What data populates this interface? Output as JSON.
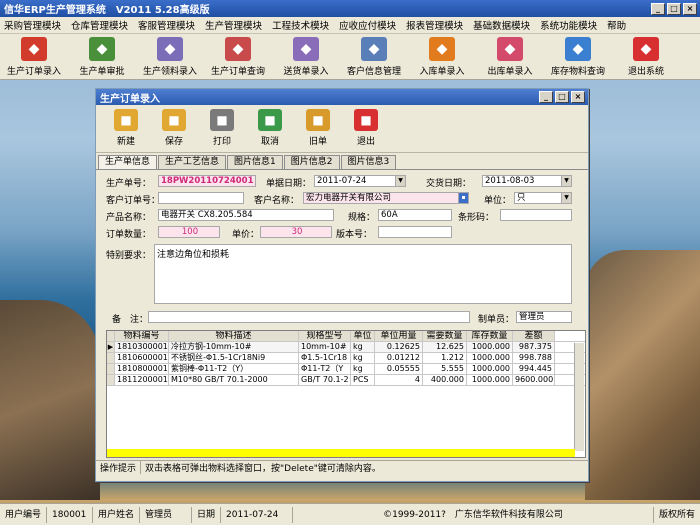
{
  "app": {
    "title": "信华ERP生产管理系统　V2011 5.28高级版"
  },
  "menu": [
    "采购管理模块",
    "仓库管理模块",
    "客服管理模块",
    "生产管理模块",
    "工程技术模块",
    "应收应付模块",
    "报表管理模块",
    "基础数据模块",
    "系统功能模块",
    "帮助"
  ],
  "toolbar": [
    {
      "label": "生产订单录入",
      "icon": "pdf-icon",
      "color": "#d23b2b"
    },
    {
      "label": "生产单审批",
      "icon": "plant-icon",
      "color": "#4a8f3a"
    },
    {
      "label": "生产领料录入",
      "icon": "document-icon",
      "color": "#7b6db8"
    },
    {
      "label": "生产订单查询",
      "icon": "arrow-doc-icon",
      "color": "#c84a4a"
    },
    {
      "label": "送货单录入",
      "icon": "paper-icon",
      "color": "#8a6db8"
    },
    {
      "label": "客户信息管理",
      "icon": "graph-icon",
      "color": "#5a7fb8"
    },
    {
      "label": "入库单录入",
      "icon": "flower-icon",
      "color": "#e27a1e"
    },
    {
      "label": "出库单录入",
      "icon": "flask-icon",
      "color": "#d34a6a"
    },
    {
      "label": "库存物料查询",
      "icon": "feather-icon",
      "color": "#3a7fd0"
    },
    {
      "label": "退出系统",
      "icon": "exit-icon",
      "color": "#d83030"
    }
  ],
  "child": {
    "title": "生产订单录入",
    "toolbar": [
      {
        "label": "新建",
        "icon": "new-icon",
        "color": "#e0a830"
      },
      {
        "label": "保存",
        "icon": "save-icon",
        "color": "#e0a830"
      },
      {
        "label": "打印",
        "icon": "print-icon",
        "color": "#7a7a7a"
      },
      {
        "label": "取消",
        "icon": "cancel-icon",
        "color": "#3a9a4a"
      },
      {
        "label": "旧单",
        "icon": "old-icon",
        "color": "#d89a2a"
      },
      {
        "label": "退出",
        "icon": "exit-icon",
        "color": "#d83030"
      }
    ],
    "tabs": [
      "生产单信息",
      "生产工艺信息",
      "图片信息1",
      "图片信息2",
      "图片信息3"
    ],
    "form": {
      "order_no_label": "生产单号：",
      "order_no": "18PW20110724001",
      "biz_date_label": "单据日期：",
      "biz_date": "2011-07-24",
      "delivery_label": "交货日期：",
      "delivery_date": "2011-08-03",
      "cust_order_label": "客户订单号：",
      "cust_order": "",
      "customer_label": "客户名称：",
      "customer": "宏力电器开关有限公司",
      "unit_label": "单位：",
      "unit": "只",
      "product_label": "产品名称：",
      "product": "电器开关 CX8.205.584",
      "spec_label": "规格：",
      "spec": "60A",
      "barcode_label": "条形码：",
      "barcode": "",
      "qty_label": "订单数量：",
      "qty": "100",
      "price_label": "单价：",
      "price": "30",
      "version_label": "版本号：",
      "version": "",
      "special_label": "特别要求：",
      "special": "注意边角位和损耗",
      "remark_label": "备　注：",
      "remark": "",
      "maker_label": "制单员：",
      "maker": "管理员"
    },
    "grid": {
      "headers": [
        "物料编号",
        "物料描述",
        "规格型号",
        "单位",
        "单位用量",
        "需要数量",
        "库存数量",
        "差额"
      ],
      "rows": [
        [
          "1810300001",
          "冷拉方钢-10mm-10#",
          "10mm-10#",
          "kg",
          "0.12625",
          "12.625",
          "1000.000",
          "987.375"
        ],
        [
          "1810600001",
          "不锈钢丝-Φ1.5-1Cr18Ni9",
          "Φ1.5-1Cr18",
          "kg",
          "0.01212",
          "1.212",
          "1000.000",
          "998.788"
        ],
        [
          "1810800001",
          "紫铜棒-Φ11-T2（Y）",
          "Φ11-T2（Y",
          "kg",
          "0.05555",
          "5.555",
          "1000.000",
          "994.445"
        ],
        [
          "1811200001",
          "M10*80 GB/T 70.1-2000",
          "GB/T 70.1-2",
          "PCS",
          "4",
          "400.000",
          "1000.000",
          "9600.000"
        ]
      ]
    },
    "hint": {
      "key": "操作提示",
      "text": "双击表格可弹出物料选择窗口，按\"Delete\"键可清除内容。"
    }
  },
  "status": [
    {
      "k": "用户编号",
      "v": "180001"
    },
    {
      "k": "用户姓名",
      "v": "管理员"
    },
    {
      "k": "日期",
      "v": "2011-07-24"
    },
    {
      "k": "",
      "v": "©1999-2011?　广东信华软件科技有限公司"
    },
    {
      "k": "",
      "v": "版权所有"
    }
  ]
}
